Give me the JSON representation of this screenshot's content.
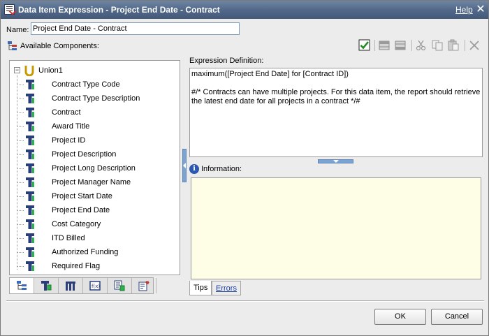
{
  "window": {
    "title": "Data Item Expression - Project End Date - Contract",
    "help_link": "Help",
    "close_glyph": "✕"
  },
  "name_field": {
    "label": "Name:",
    "value": "Project End Date - Contract"
  },
  "available_components": {
    "label": "Available Components:",
    "tree": {
      "root": {
        "label": "Union1",
        "icon": "union-icon",
        "expander": "−"
      },
      "items": [
        "Contract Type Code",
        "Contract Type Description",
        "Contract",
        "Award Title",
        "Project ID",
        "Project Description",
        "Project Long Description",
        "Project Manager Name",
        "Project Start Date",
        "Project End Date",
        "Cost Category",
        "ITD Billed",
        "Authorized Funding",
        "Required Flag"
      ]
    },
    "bottom_tabs": [
      {
        "name": "source-tab",
        "icon": "source-tree-icon"
      },
      {
        "name": "data-items-tab",
        "icon": "data-items-icon"
      },
      {
        "name": "query-items-tab",
        "icon": "query-items-icon"
      },
      {
        "name": "functions-tab",
        "icon": "functions-icon"
      },
      {
        "name": "parameters-tab",
        "icon": "parameters-icon"
      },
      {
        "name": "macros-tab",
        "icon": "macros-icon"
      }
    ]
  },
  "toolbar": {
    "buttons": [
      {
        "name": "validate-button",
        "icon": "checkmark-icon"
      },
      {
        "name": "insert-before-button",
        "icon": "insert-before-icon"
      },
      {
        "name": "insert-after-button",
        "icon": "insert-after-icon"
      },
      {
        "name": "cut-button",
        "icon": "cut-icon"
      },
      {
        "name": "copy-button",
        "icon": "copy-icon"
      },
      {
        "name": "paste-button",
        "icon": "paste-icon"
      },
      {
        "name": "delete-button",
        "icon": "delete-icon"
      }
    ],
    "colors": {
      "check": "#1a8a1a",
      "disabled": "#9a9a9a"
    }
  },
  "expression": {
    "label": "Expression Definition:",
    "value": "maximum([Project End Date] for [Contract ID])\n\n#/* Contracts can have multiple projects. For this data item, the report should retrieve the latest end date for all projects in a contract */#"
  },
  "information": {
    "label": "Information:",
    "icon": "info-icon",
    "icon_glyph": "i",
    "tabs": [
      {
        "label": "Tips",
        "active": true
      },
      {
        "label": "Errors",
        "active": false
      }
    ]
  },
  "buttons": {
    "ok": "OK",
    "cancel": "Cancel"
  },
  "colors": {
    "titlebar": "#52698a",
    "info_bg": "#fefee6",
    "splitter": "#7da3d0",
    "link": "#1c3fa6"
  }
}
